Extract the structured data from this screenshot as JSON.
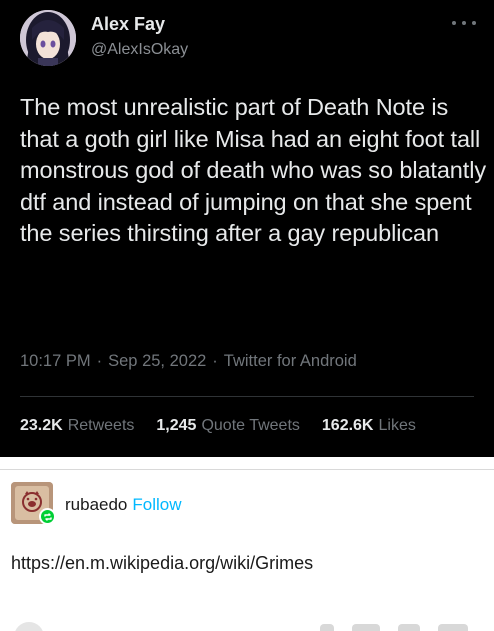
{
  "tweet": {
    "author": {
      "name": "Alex Fay",
      "handle": "@AlexIsOkay",
      "avatar_icon": "anime-girl-avatar"
    },
    "more_icon": "more-horizontal-icon",
    "text": "The most unrealistic part of Death Note is that a goth girl like Misa had an eight foot tall monstrous god of death who was so blatantly dtf and instead of jumping on that she spent the series thirsting after a gay republican",
    "meta": {
      "time": "10:17 PM",
      "date": "Sep 25, 2022",
      "source": "Twitter for Android",
      "separator": "·"
    },
    "stats": [
      {
        "value": "23.2K",
        "label": "Retweets"
      },
      {
        "value": "1,245",
        "label": "Quote Tweets"
      },
      {
        "value": "162.6K",
        "label": "Likes"
      }
    ],
    "colors": {
      "background": "#000000",
      "text": "#e7e9ea",
      "muted": "#71767b"
    }
  },
  "reblog": {
    "username": "rubaedo",
    "follow_label": "Follow",
    "avatar_icon": "pig-sign-avatar",
    "badge_icon": "reblog-icon",
    "link_text": "https://en.m.wikipedia.org/wiki/Grimes",
    "colors": {
      "follow": "#00b8ff",
      "badge": "#00cf35"
    }
  }
}
